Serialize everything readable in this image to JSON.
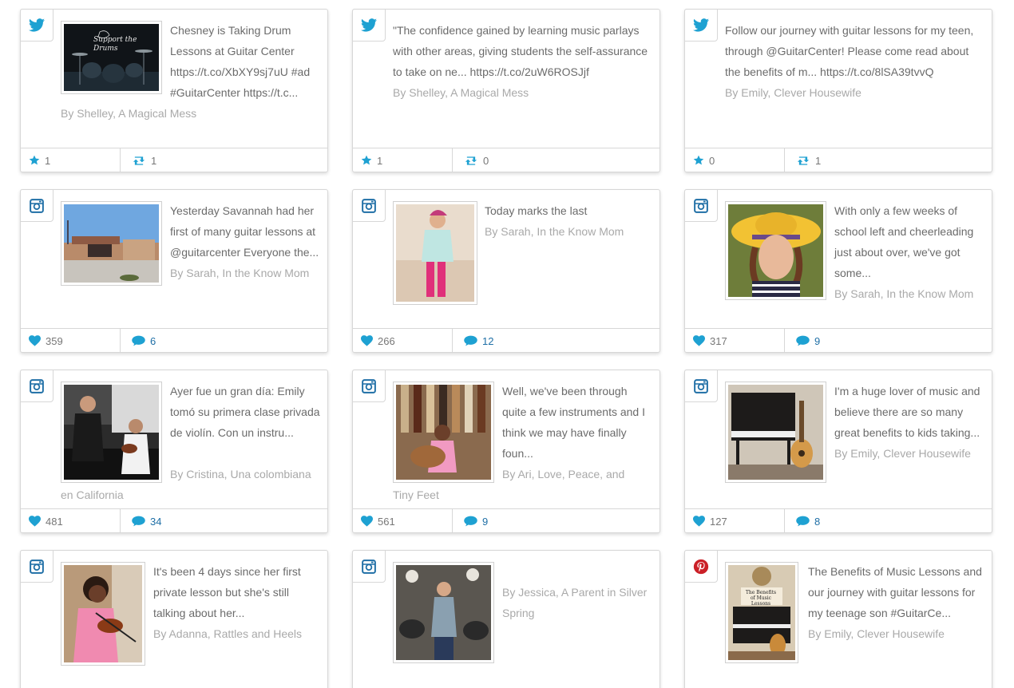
{
  "colors": {
    "accent": "#1ea1d2",
    "pinterest": "#cb2027",
    "text": "#6b6b6b",
    "byline": "#a9a9a9"
  },
  "cards": [
    {
      "network_icon": "twitter-icon",
      "text": "Chesney is Taking Drum Lessons at Guitar Center https://t.co/XbXY9sj7uU #ad #GuitarCenter https://t.c...",
      "byline": "By Shelley, A Magical Mess",
      "image_caption": "Support the Drums",
      "stat1_icon": "star-icon",
      "stat1": "1",
      "stat2_icon": "retweet-icon",
      "stat2": "1"
    },
    {
      "network_icon": "twitter-icon",
      "text": "\"The confidence gained by learning music parlays with other areas, giving students the self-assurance to take on ne... https://t.co/2uW6ROSJjf",
      "byline": "By Shelley, A Magical Mess",
      "stat1_icon": "star-icon",
      "stat1": "1",
      "stat2_icon": "retweet-icon",
      "stat2": "0"
    },
    {
      "network_icon": "twitter-icon",
      "text": "Follow our journey with guitar lessons for my teen, through @GuitarCenter! Please come read about the benefits of m... https://t.co/8lSA39tvvQ",
      "byline": "By Emily, Clever Housewife",
      "stat1_icon": "star-icon",
      "stat1": "0",
      "stat2_icon": "retweet-icon",
      "stat2": "1"
    },
    {
      "network_icon": "instagram-icon",
      "text": "Yesterday Savannah had her first of many guitar lessons at @guitarcenter Everyone the...",
      "byline": "By Sarah, In the Know Mom",
      "stat1_icon": "heart-icon",
      "stat1": "359",
      "stat2_icon": "comment-icon",
      "stat2": "6"
    },
    {
      "network_icon": "instagram-icon",
      "text": "Today marks the last",
      "byline": "By Sarah, In the Know Mom",
      "stat1_icon": "heart-icon",
      "stat1": "266",
      "stat2_icon": "comment-icon",
      "stat2": "12"
    },
    {
      "network_icon": "instagram-icon",
      "text": "With only a few weeks of school left and cheerleading just about over, we've got some...",
      "byline": "By Sarah, In the Know Mom",
      "stat1_icon": "heart-icon",
      "stat1": "317",
      "stat2_icon": "comment-icon",
      "stat2": "9"
    },
    {
      "network_icon": "instagram-icon",
      "text": "Ayer fue un gran día: Emily tomó su primera clase privada de violín. Con un instru...",
      "byline": "By Cristina, Una colombiana en California",
      "stat1_icon": "heart-icon",
      "stat1": "481",
      "stat2_icon": "comment-icon",
      "stat2": "34"
    },
    {
      "network_icon": "instagram-icon",
      "text": "Well, we've been through quite a few instruments and I think we may have finally foun...",
      "byline": "By Ari, Love, Peace, and Tiny Feet",
      "stat1_icon": "heart-icon",
      "stat1": "561",
      "stat2_icon": "comment-icon",
      "stat2": "9"
    },
    {
      "network_icon": "instagram-icon",
      "text": "I'm a huge lover of music and believe there are so many great benefits to kids taking...",
      "byline": "By Emily, Clever Housewife",
      "stat1_icon": "heart-icon",
      "stat1": "127",
      "stat2_icon": "comment-icon",
      "stat2": "8"
    },
    {
      "network_icon": "instagram-icon",
      "text": "It's been 4 days since her first private lesson but she's still talking about her...",
      "byline": "By Adanna, Rattles and Heels"
    },
    {
      "network_icon": "instagram-icon",
      "text": "",
      "byline": "By Jessica, A Parent in Silver Spring"
    },
    {
      "network_icon": "pinterest-icon",
      "text": "The Benefits of Music Lessons and our journey with guitar lessons for my teenage son #GuitarCe...",
      "byline": "By Emily, Clever Housewife",
      "image_caption": "The Benefits of Music Lessons"
    }
  ]
}
